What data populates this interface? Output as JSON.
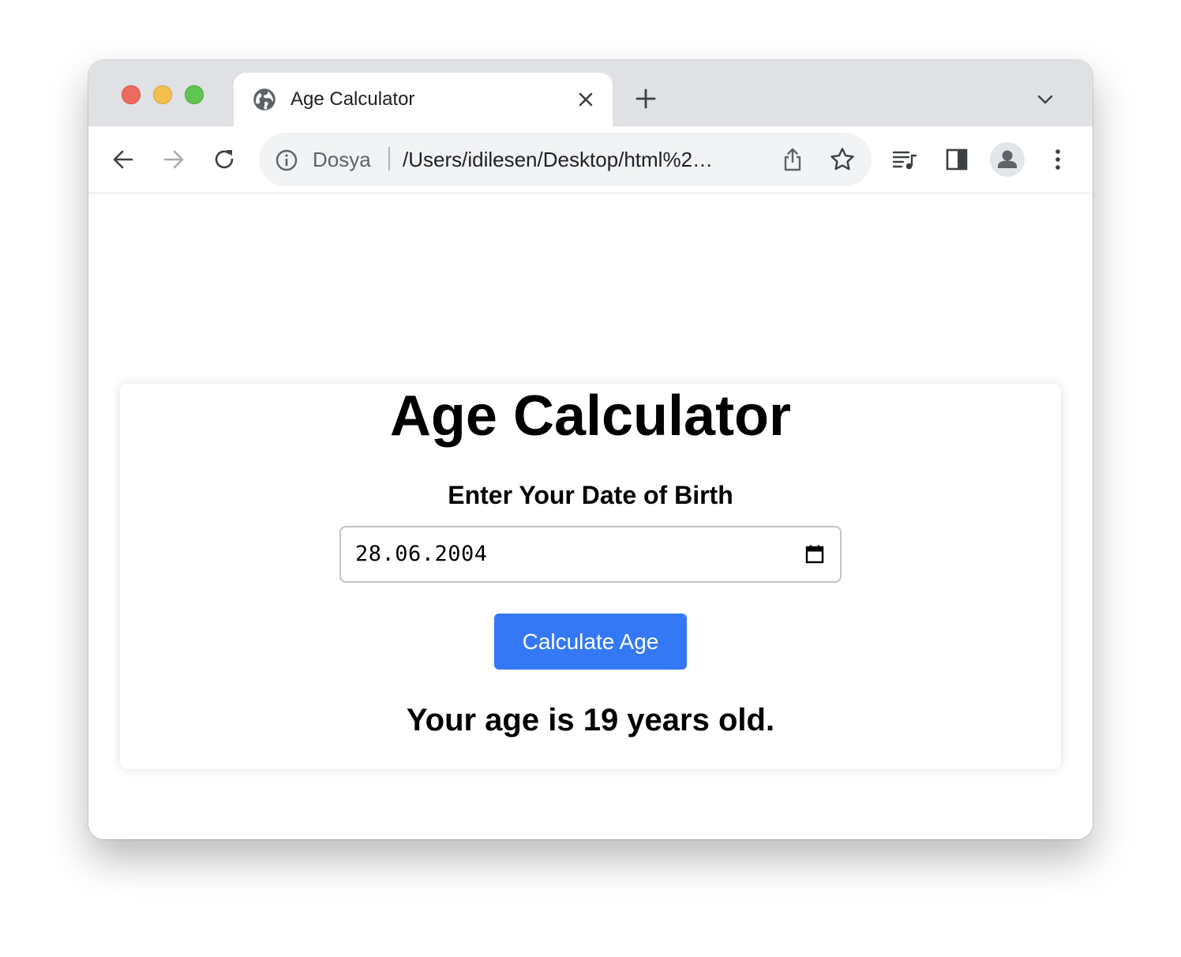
{
  "browser": {
    "tab": {
      "title": "Age Calculator"
    },
    "omnibox": {
      "scheme_label": "Dosya",
      "url": "/Users/idilesen/Desktop/html%2…"
    },
    "icons": {
      "tab_favicon": "globe-icon",
      "tab_close": "close-icon",
      "new_tab": "plus-icon",
      "tab_search": "chevron-down-icon",
      "back": "arrow-left-icon",
      "forward": "arrow-right-icon",
      "reload": "reload-icon",
      "site_info": "info-icon",
      "share": "share-icon",
      "bookmark": "star-icon",
      "media": "media-queue-icon",
      "side_panel": "side-panel-icon",
      "profile": "person-icon",
      "menu": "kebab-menu-icon"
    }
  },
  "page": {
    "title": "Age Calculator",
    "dob_label": "Enter Your Date of Birth",
    "date_value": "28.06.2004",
    "button_label": "Calculate Age",
    "result_text": "Your age is 19 years old."
  },
  "colors": {
    "button_bg": "#3478f6",
    "button_text": "#ffffff",
    "tabstrip_bg": "#dfe1e5",
    "omnibox_bg": "#f1f3f4"
  }
}
